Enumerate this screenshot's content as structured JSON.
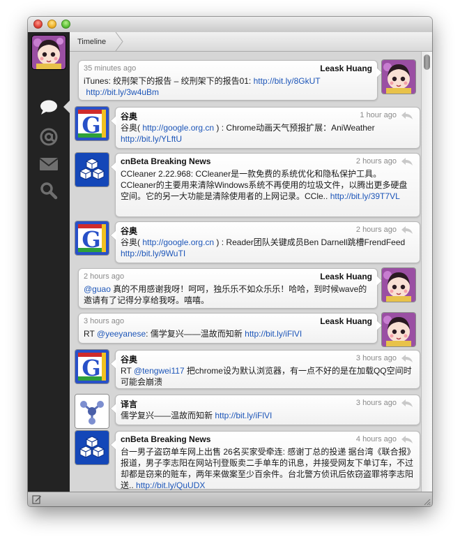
{
  "breadcrumb": "Timeline",
  "sidebar": {
    "items": [
      {
        "icon": "speech-bubble-icon",
        "label": "timeline"
      },
      {
        "icon": "at-icon",
        "label": "mentions"
      },
      {
        "icon": "envelope-icon",
        "label": "messages"
      },
      {
        "icon": "search-icon",
        "label": "search"
      }
    ]
  },
  "tweets": [
    {
      "name": "Leask Huang",
      "time": "35 minutes ago",
      "text": "iTunes: 绞刑架下的报告 – 绞刑架下的报告01: ",
      "link1": "http://bit.ly/8GkUT",
      "link2": "http://bit.ly/3w4uBm",
      "own": true
    },
    {
      "name": "谷奥",
      "time": "1 hour ago",
      "pre": "谷奥( ",
      "link1": "http://google.org.cn",
      "mid": " ) : Chrome动画天气预报扩展：AniWeather",
      "link2": "http://bit.ly/YLftU",
      "own": false
    },
    {
      "name": "cnBeta Breaking News",
      "time": "2 hours ago",
      "text": "CCleaner 2.22.968: CCleaner是一款免费的系统优化和隐私保护工具。CCleaner的主要用来清除Windows系统不再使用的垃圾文件，以腾出更多硬盘空间。它的另一大功能是清除使用者的上网记录。CCle.. ",
      "link1": "http://bit.ly/39T7VL",
      "own": false
    },
    {
      "name": "谷奥",
      "time": "2 hours ago",
      "pre": "谷奥( ",
      "link1": "http://google.org.cn",
      "mid": " ) : Reader团队关键成员Ben Darnell跳槽FrendFeed ",
      "link2": "http://bit.ly/9WuTI",
      "own": false
    },
    {
      "name": "Leask Huang",
      "time": "2 hours ago",
      "link1": "@guao",
      "text": " 真的不用感谢我呀！呵呵，独乐乐不如众乐乐！哈哈，到时候wave的邀请有了记得分享给我呀。嘻嘻。",
      "own": true
    },
    {
      "name": "Leask Huang",
      "time": "3 hours ago",
      "pre": "RT ",
      "link1": "@yeeyanese",
      "text": ": 儒学复兴——温故而知新 ",
      "link2": "http://bit.ly/iFlVI",
      "own": true
    },
    {
      "name": "谷奥",
      "time": "3 hours ago",
      "pre": "RT ",
      "link1": "@tengwei117",
      "text": " 把chrome设为默认浏览器，有一点不好的是在加载QQ空间时可能会崩溃",
      "own": false
    },
    {
      "name": "译言",
      "time": "3 hours ago",
      "text": "儒学复兴——温故而知新 ",
      "link1": "http://bit.ly/iFlVI",
      "own": false
    },
    {
      "name": "cnBeta Breaking News",
      "time": "4 hours ago",
      "text": "台一男子盗窃单车网上出售 26名买家受牵连: 感谢丁总的投递 据台湾《联合报》报道，男子李志阳在网站刊登贩卖二手单车的讯息，并接受网友下单订车，不过却都是窃来的赃车，两年来做案至少百余件。台北警方侦讯后依窃盗罪将李志阳送.. ",
      "link1": "http://bit.ly/QuUDX",
      "own": false
    }
  ],
  "colors": {
    "link": "#1c55b8",
    "sidebar": "#232323",
    "background": "#d6d6d6"
  }
}
